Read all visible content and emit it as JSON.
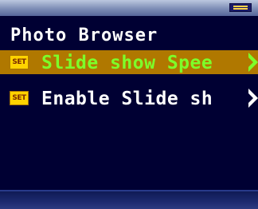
{
  "screen": {
    "title": "Photo Browser",
    "battery_icon": "battery-icon"
  },
  "menu": {
    "items": [
      {
        "icon": "SET",
        "label": "Slide show Spee",
        "selected": true
      },
      {
        "icon": "SET",
        "label": "Enable Slide sh",
        "selected": false
      }
    ]
  },
  "colors": {
    "background": "#000033",
    "selected_bg": "#b07800",
    "selected_text": "#7dff2a",
    "normal_text": "#ffffff",
    "icon_bg": "#ffd300"
  }
}
